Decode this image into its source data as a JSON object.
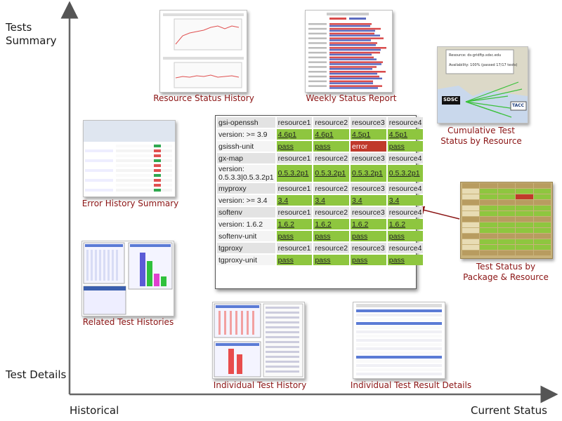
{
  "axes": {
    "y_label": "Tests\nSummary",
    "y_bottom_label": "Test Details",
    "x_left_label": "Historical",
    "x_right_label": "Current Status"
  },
  "captions": {
    "resource_status_history": "Resource Status History",
    "weekly_status_report": "Weekly Status Report",
    "cumulative_test_status": "Cumulative Test\nStatus by Resource",
    "error_history_summary": "Error History Summary",
    "test_status_by_package": "Test Status by\nPackage & Resource",
    "related_test_histories": "Related Test Histories",
    "individual_test_history": "Individual Test History",
    "individual_test_result_details": "Individual Test Result Details"
  },
  "map_thumb": {
    "resource_text": "Resource: ds-gridftp.sdsc.edu",
    "availability_text": "Availability: 100% (passed 17/17 tests)",
    "sdsc_label": "SDSC",
    "tacc_label": "TACC"
  },
  "colors": {
    "pass": "#8ec63f",
    "error": "#c0392b",
    "caption": "#8b1414",
    "arrow": "#8b1414"
  },
  "main_table": {
    "resources": [
      "resource1",
      "resource2",
      "resource3",
      "resource4"
    ],
    "packages": [
      {
        "name": "gsi-openssh",
        "version_label": "version: >= 3.9",
        "versions": [
          "4.6p1",
          "4.6p1",
          "4.5p1",
          "4.5p1"
        ],
        "unit_label": "gsissh-unit",
        "units": [
          "pass",
          "pass",
          "error",
          "pass"
        ]
      },
      {
        "name": "gx-map",
        "version_label": "version:\n0.5.3.3|0.5.3.2p1",
        "versions": [
          "0.5.3.2p1",
          "0.5.3.2p1",
          "0.5.3.2p1",
          "0.5.3.2p1"
        ]
      },
      {
        "name": "myproxy",
        "version_label": "version: >= 3.4",
        "versions": [
          "3.4",
          "3.4",
          "3.4",
          "3.4"
        ]
      },
      {
        "name": "softenv",
        "version_label": "version: 1.6.2",
        "versions": [
          "1.6.2",
          "1.6.2",
          "1.6.2",
          "1.6.2"
        ],
        "unit_label": "softenv-unit",
        "units": [
          "pass",
          "pass",
          "pass",
          "pass"
        ]
      },
      {
        "name": "tgproxy",
        "unit_label": "tgproxy-unit",
        "units": [
          "pass",
          "pass",
          "pass",
          "pass"
        ]
      }
    ]
  }
}
